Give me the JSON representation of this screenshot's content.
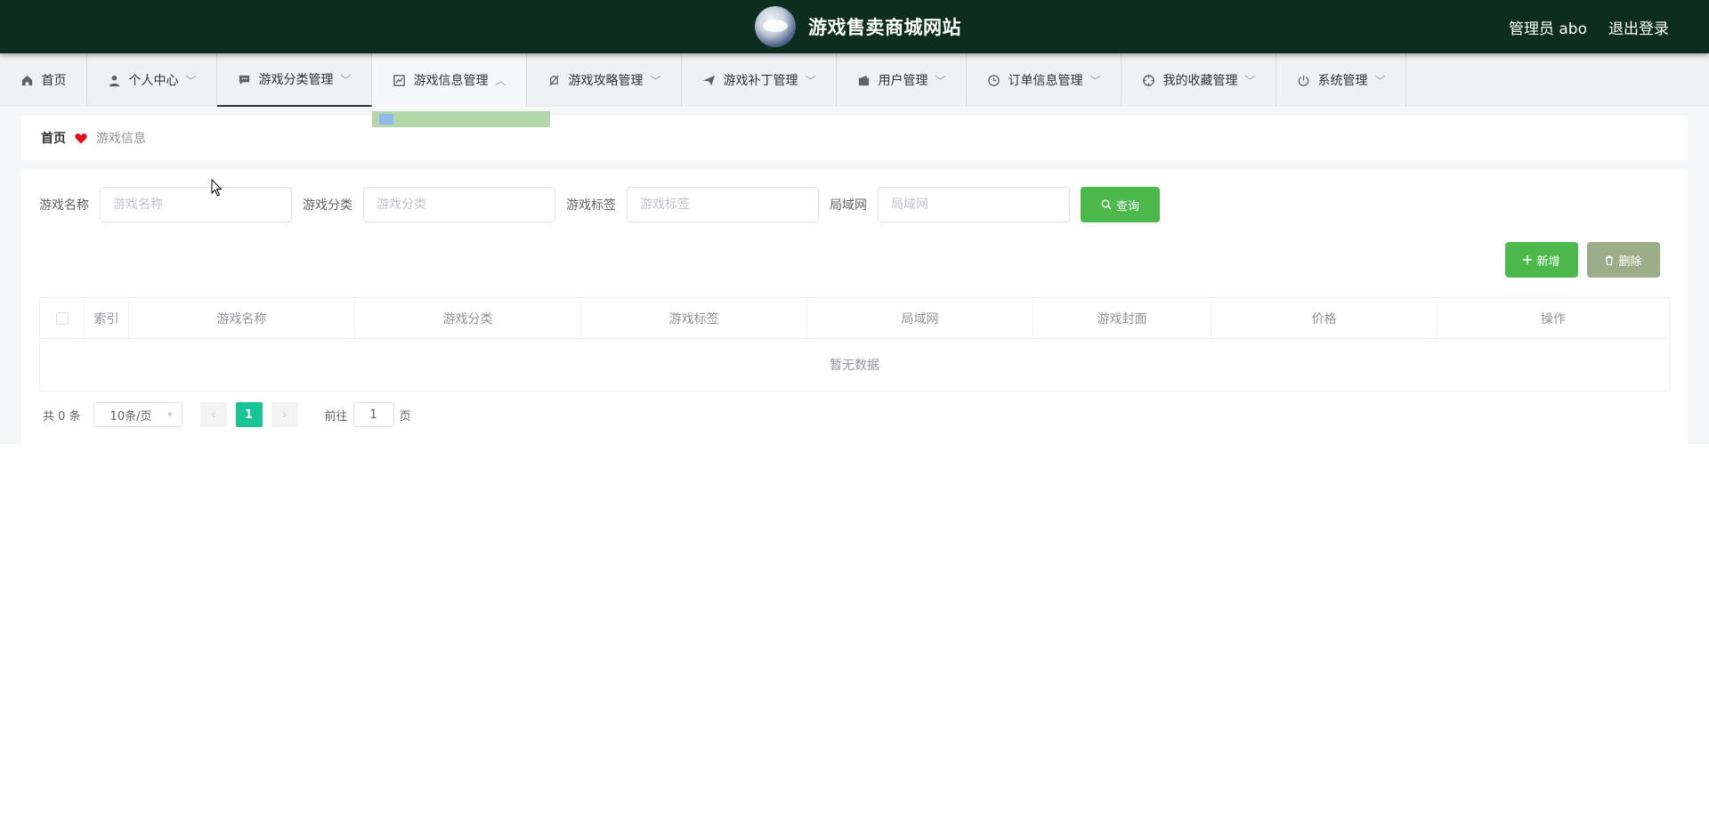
{
  "header": {
    "title": "游戏售卖商城网站",
    "user_label": "管理员 abo",
    "logout_label": "退出登录"
  },
  "nav": {
    "items": [
      {
        "label": "首页",
        "icon": "home-icon"
      },
      {
        "label": "个人中心",
        "icon": "user-icon"
      },
      {
        "label": "游戏分类管理",
        "icon": "chat-icon"
      },
      {
        "label": "游戏信息管理",
        "icon": "chart-icon"
      },
      {
        "label": "游戏攻略管理",
        "icon": "bell-off-icon"
      },
      {
        "label": "游戏补丁管理",
        "icon": "send-icon"
      },
      {
        "label": "用户管理",
        "icon": "wallet-icon"
      },
      {
        "label": "订单信息管理",
        "icon": "clock-icon"
      },
      {
        "label": "我的收藏管理",
        "icon": "crosshair-icon"
      },
      {
        "label": "系统管理",
        "icon": "power-icon"
      }
    ],
    "active_index": 2
  },
  "breadcrumb": {
    "home": "首页",
    "current": "游戏信息"
  },
  "search": {
    "fields": [
      {
        "label": "游戏名称",
        "placeholder": "游戏名称"
      },
      {
        "label": "游戏分类",
        "placeholder": "游戏分类"
      },
      {
        "label": "游戏标签",
        "placeholder": "游戏标签"
      },
      {
        "label": "局域网",
        "placeholder": "局域网"
      }
    ],
    "button_label": "查询"
  },
  "actions": {
    "add_label": "新增",
    "delete_label": "删除"
  },
  "table": {
    "columns": [
      "索引",
      "游戏名称",
      "游戏分类",
      "游戏标签",
      "局域网",
      "游戏封面",
      "价格",
      "操作"
    ],
    "empty_text": "暂无数据"
  },
  "pagination": {
    "total_text": "共 0 条",
    "page_size": "10条/页",
    "current_page": "1",
    "goto_label": "前往",
    "goto_value": "1",
    "page_suffix": "页"
  },
  "colors": {
    "header_bg": "#0d2e1e",
    "primary_green": "#4db84b",
    "delete_btn": "#9cad8a",
    "page_active": "#17c495"
  }
}
